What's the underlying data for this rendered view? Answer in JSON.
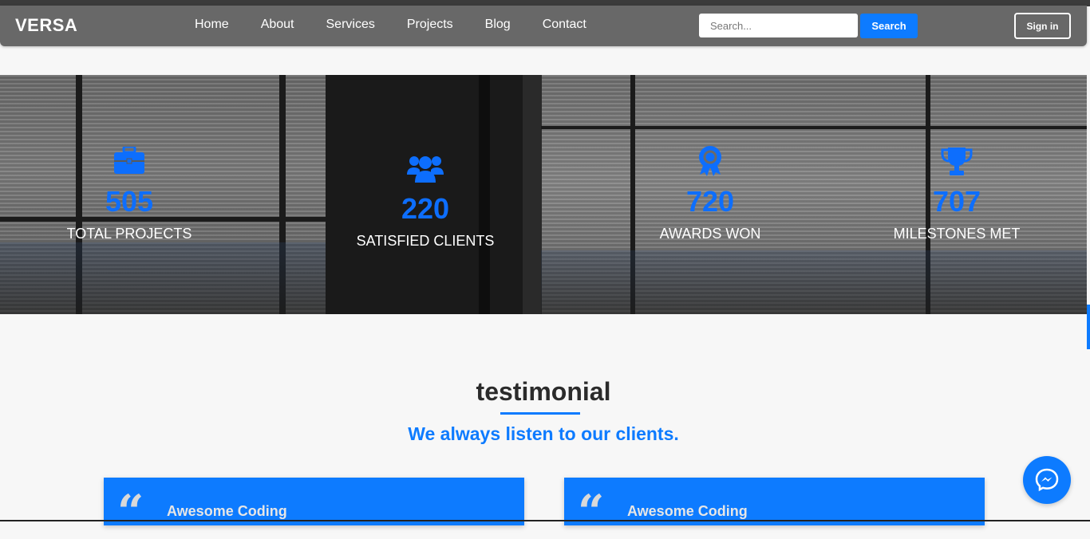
{
  "brand": "VERSA",
  "nav": {
    "links": [
      "Home",
      "About",
      "Services",
      "Projects",
      "Blog",
      "Contact"
    ],
    "search_placeholder": "Search...",
    "search_button": "Search",
    "signin_button": "Sign in"
  },
  "stats": [
    {
      "icon": "briefcase-icon",
      "number": "505",
      "label": "TOTAL PROJECTS"
    },
    {
      "icon": "users-icon",
      "number": "220",
      "label": "SATISFIED CLIENTS"
    },
    {
      "icon": "award-icon",
      "number": "720",
      "label": "AWARDS WON"
    },
    {
      "icon": "trophy-icon",
      "number": "707",
      "label": "MILESTONES MET"
    }
  ],
  "testimonial": {
    "title": "testimonial",
    "subtitle": "We always listen to our clients.",
    "cards": [
      {
        "quote_mark": "“",
        "title": "Awesome Coding"
      },
      {
        "quote_mark": "“",
        "title": "Awesome Coding"
      }
    ]
  },
  "colors": {
    "accent": "#0d7bff",
    "stat_number": "#0d6efd",
    "navbar": "#686868"
  }
}
